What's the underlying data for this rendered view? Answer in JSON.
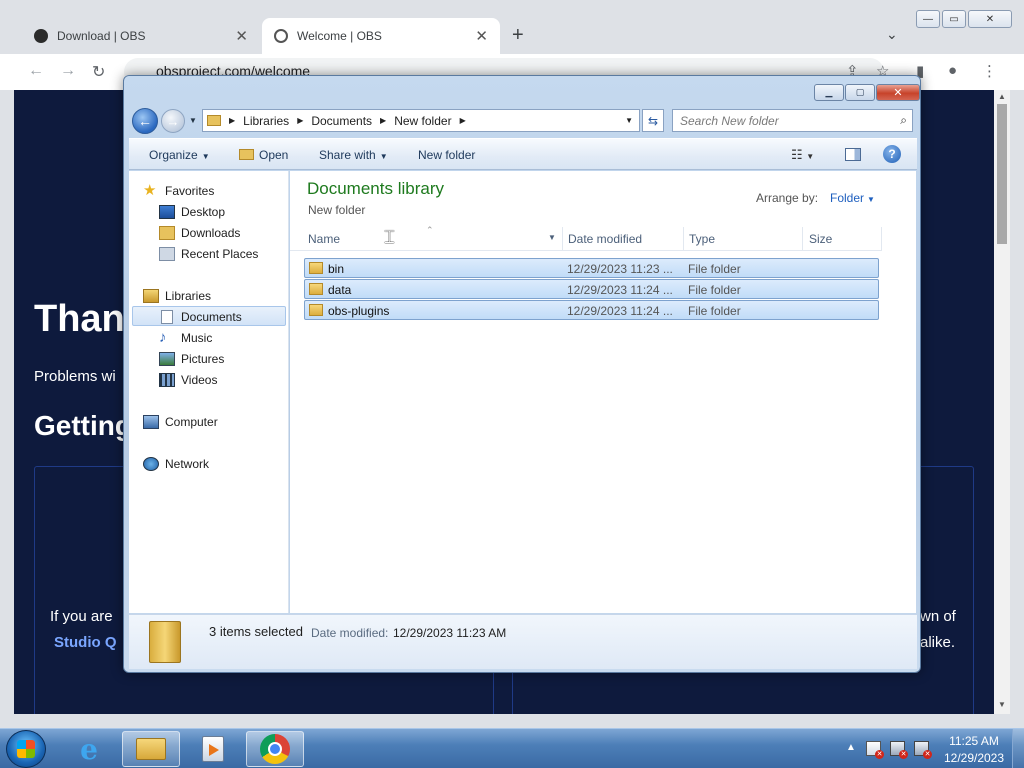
{
  "browser": {
    "tabs": [
      {
        "title": "Download | OBS"
      },
      {
        "title": "Welcome | OBS"
      }
    ],
    "new_tab": "+",
    "url": "obsproject.com/welcome"
  },
  "webpage": {
    "heading": "Than",
    "paragraph": "Problems wi",
    "subheading": "Getting",
    "line_left": "If you are",
    "link_left": "Studio Q",
    "line_right": "wn of",
    "line_right2": "alike."
  },
  "explorer": {
    "breadcrumb": [
      "Libraries",
      "Documents",
      "New folder"
    ],
    "search_placeholder": "Search New folder",
    "commands": {
      "organize": "Organize",
      "open": "Open",
      "share_with": "Share with",
      "new_folder": "New folder"
    },
    "nav": {
      "favorites": "Favorites",
      "desktop": "Desktop",
      "downloads": "Downloads",
      "recent_places": "Recent Places",
      "libraries": "Libraries",
      "documents": "Documents",
      "music": "Music",
      "pictures": "Pictures",
      "videos": "Videos",
      "computer": "Computer",
      "network": "Network"
    },
    "library_title": "Documents library",
    "library_subtitle": "New folder",
    "arrange_label": "Arrange by:",
    "arrange_value": "Folder",
    "columns": {
      "name": "Name",
      "date_modified": "Date modified",
      "type": "Type",
      "size": "Size"
    },
    "files": [
      {
        "name": "bin",
        "date": "12/29/2023 11:23 ...",
        "type": "File folder"
      },
      {
        "name": "data",
        "date": "12/29/2023 11:24 ...",
        "type": "File folder"
      },
      {
        "name": "obs-plugins",
        "date": "12/29/2023 11:24 ...",
        "type": "File folder"
      }
    ],
    "details": {
      "count": "3 items selected",
      "date_label": "Date modified:",
      "date_value": "12/29/2023 11:23 AM"
    }
  },
  "taskbar": {
    "time": "11:25 AM",
    "date": "12/29/2023"
  }
}
